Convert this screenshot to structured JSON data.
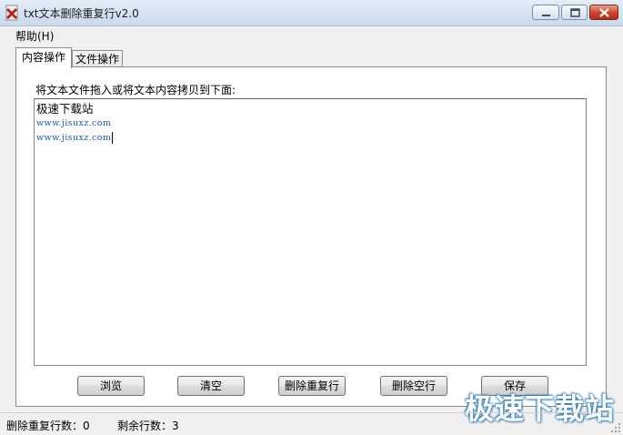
{
  "window": {
    "title": "txt文本删除重复行v2.0"
  },
  "menu": {
    "help": "帮助(H)"
  },
  "tabs": [
    {
      "label": "内容操作",
      "active": true
    },
    {
      "label": "文件操作",
      "active": false
    }
  ],
  "content": {
    "instruction": "将文本文件拖入或将文本内容拷贝到下面:",
    "lines": [
      "极速下载站",
      "www.jisuxz.com",
      "www.jisuxz.com"
    ]
  },
  "buttons": {
    "browse": "浏览",
    "clear": "清空",
    "delete_duplicates": "删除重复行",
    "delete_empty": "删除空行",
    "save": "保存"
  },
  "status": {
    "duplicates_removed": "删除重复行数：0",
    "remaining_lines": "剩余行数：3"
  },
  "watermark": "极速下载站",
  "icons": {
    "app": "app-icon",
    "minimize": "minimize-icon",
    "maximize": "maximize-icon",
    "close": "close-icon",
    "grip": "resize-grip-icon"
  },
  "colors": {
    "url_text": "#1b5aa8",
    "close_button": "#c9412a",
    "watermark_outline": "#2f7fbf"
  }
}
